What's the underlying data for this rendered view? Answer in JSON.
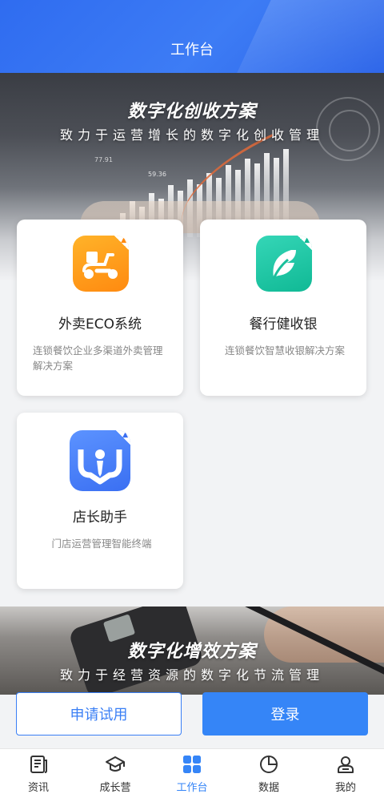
{
  "header": {
    "title": "工作台"
  },
  "banner_top": {
    "title": "数字化创收方案",
    "subtitle": "致力于运营增长的数字化创收管理",
    "chart_text": [
      "77.91",
      "59.36"
    ]
  },
  "apps": [
    {
      "name": "外卖ECO系统",
      "desc": "连锁餐饮企业多渠道外卖管理解决方案",
      "icon": "scooter-icon",
      "color": "#ff9a1a"
    },
    {
      "name": "餐行健收银",
      "desc": "连锁餐饮智慧收银解决方案",
      "icon": "leaf-icon",
      "color": "#1cc7a4"
    },
    {
      "name": "店长助手",
      "desc": "门店运营管理智能终端",
      "icon": "manager-icon",
      "color": "#4a80f8"
    }
  ],
  "banner_bottom": {
    "title": "数字化增效方案",
    "subtitle": "致力于经营资源的数字化节流管理"
  },
  "actions": {
    "trial": "申请试用",
    "login": "登录"
  },
  "tabbar": [
    {
      "label": "资讯",
      "icon": "news-icon"
    },
    {
      "label": "成长营",
      "icon": "graduation-cap-icon"
    },
    {
      "label": "工作台",
      "icon": "grid-icon",
      "active": true
    },
    {
      "label": "数据",
      "icon": "pie-chart-icon"
    },
    {
      "label": "我的",
      "icon": "user-icon"
    }
  ],
  "colors": {
    "primary": "#3585f7",
    "header": "#3070f0"
  }
}
